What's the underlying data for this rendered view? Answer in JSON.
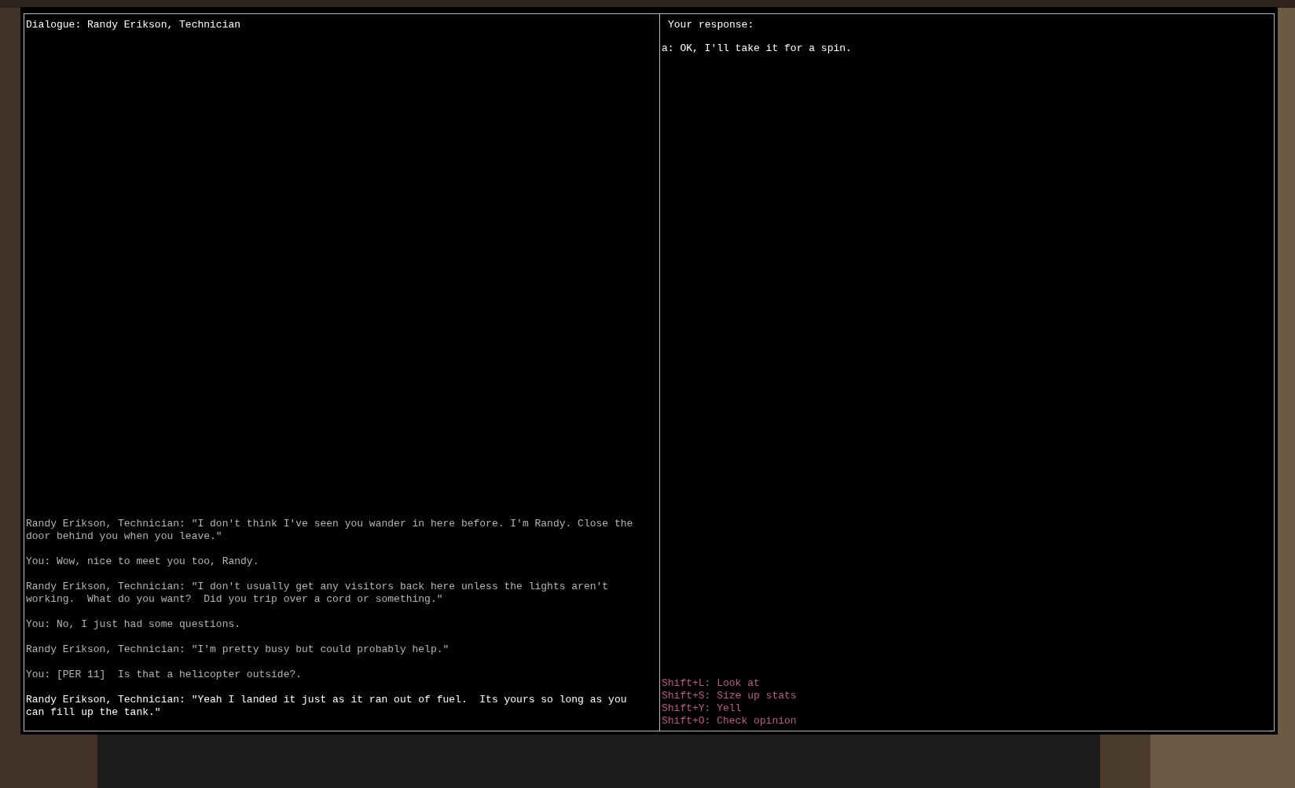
{
  "dialogue": {
    "title": "Dialogue: Randy Erikson, Technician",
    "messages": [
      {
        "text": "Randy Erikson, Technician: \"I don't think I've seen you wander in here before. I'm Randy. Close the door behind you when you leave.\"",
        "latest": false
      },
      {
        "text": "You: Wow, nice to meet you too, Randy.",
        "latest": false
      },
      {
        "text": "Randy Erikson, Technician: \"I don't usually get any visitors back here unless the lights aren't working.  What do you want?  Did you trip over a cord or something.\"",
        "latest": false
      },
      {
        "text": "You: No, I just had some questions.",
        "latest": false
      },
      {
        "text": "Randy Erikson, Technician: \"I'm pretty busy but could probably help.\"",
        "latest": false
      },
      {
        "text": "You: [PER 11]  Is that a helicopter outside?.",
        "latest": false
      },
      {
        "text": "Randy Erikson, Technician: \"Yeah I landed it just as it ran out of fuel.  Its yours so long as you can fill up the tank.\"",
        "latest": true
      }
    ]
  },
  "response": {
    "title": "Your response:",
    "options": [
      "a: OK, I'll take it for a spin."
    ],
    "hotkeys": [
      "Shift+L: Look at",
      "Shift+S: Size up stats",
      "Shift+Y: Yell",
      "Shift+O: Check opinion"
    ]
  }
}
